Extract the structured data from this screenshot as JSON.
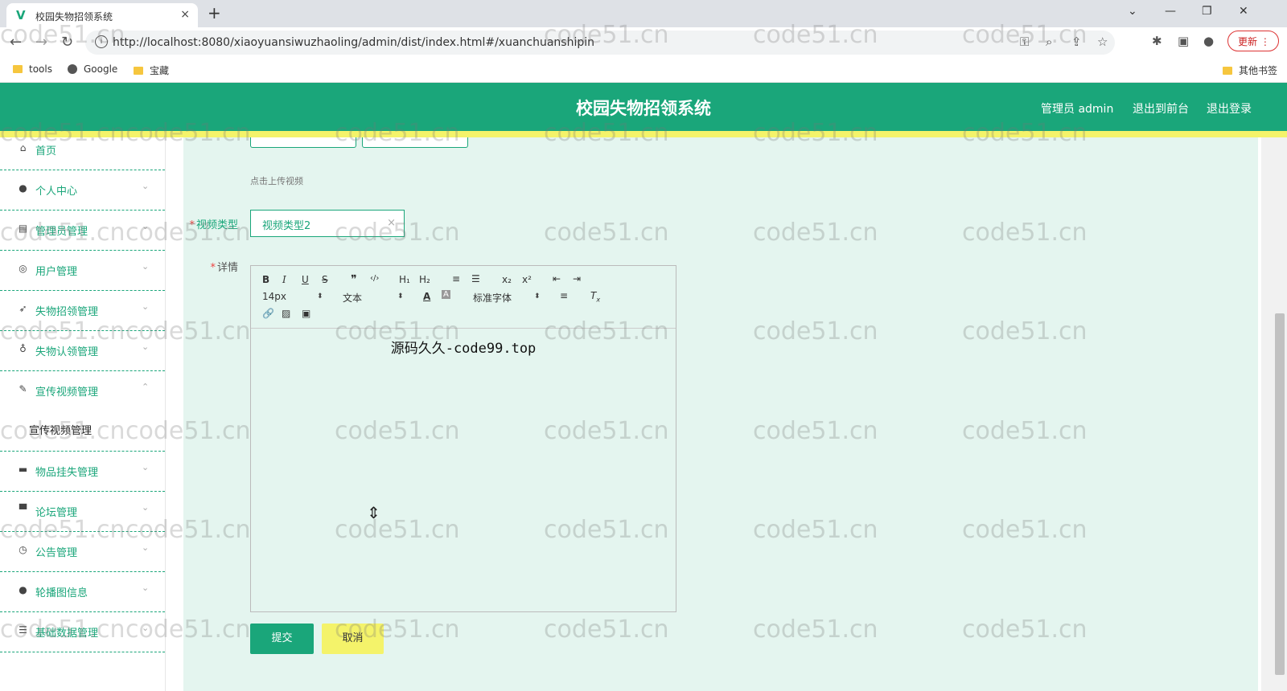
{
  "browser": {
    "tab_title": "校园失物招领系统",
    "tab_close": "×",
    "new_tab": "+",
    "url": "http://localhost:8080/xiaoyuansiwuzhaoling/admin/dist/index.html#/xuanchuanshipin",
    "update_label": "更新",
    "bookmarks": [
      "tools",
      "Google",
      "宝藏"
    ],
    "other_bookmarks": "其他书签"
  },
  "header": {
    "title": "校园失物招领系统",
    "links": [
      "管理员 admin",
      "退出到前台",
      "退出登录"
    ]
  },
  "sidebar": {
    "items": [
      {
        "label": "首页",
        "icon": "home-icon"
      },
      {
        "label": "个人中心",
        "icon": "user-icon"
      },
      {
        "label": "管理员管理",
        "icon": "id-card-icon"
      },
      {
        "label": "用户管理",
        "icon": "users-circle-icon"
      },
      {
        "label": "失物招领管理",
        "icon": "send-icon"
      },
      {
        "label": "失物认领管理",
        "icon": "microphone-icon"
      },
      {
        "label": "宣传视频管理",
        "icon": "video-icon"
      },
      {
        "label": "物品挂失管理",
        "icon": "briefcase-icon"
      },
      {
        "label": "论坛管理",
        "icon": "monitor-icon"
      },
      {
        "label": "公告管理",
        "icon": "clock-icon"
      },
      {
        "label": "轮播图信息",
        "icon": "user-icon"
      },
      {
        "label": "基础数据管理",
        "icon": "list-icon"
      }
    ],
    "sub_item": "宣传视频管理",
    "expanded_index": 6
  },
  "form": {
    "upload_hint": "点击上传视频",
    "video_type_label": "视频类型",
    "video_type_value": "视频类型2",
    "clear_symbol": "×",
    "detail_label": "详情",
    "editor": {
      "toolbar_row1": [
        "B",
        "I",
        "U",
        "S",
        "❞",
        "‹/›",
        "H₁",
        "H₂",
        "≡",
        "☰",
        "x₂",
        "x²",
        "⇤",
        "⇥"
      ],
      "font_size": "14px",
      "text_type": "文本",
      "font_family": "标准字体",
      "content": "源码久久-code99.top"
    },
    "submit": "提交",
    "cancel": "取消"
  },
  "watermark": "code51.cn",
  "colors": {
    "primary": "#1aa67a",
    "accent_yellow": "#f4f36a",
    "main_bg": "#e4f5ef"
  }
}
